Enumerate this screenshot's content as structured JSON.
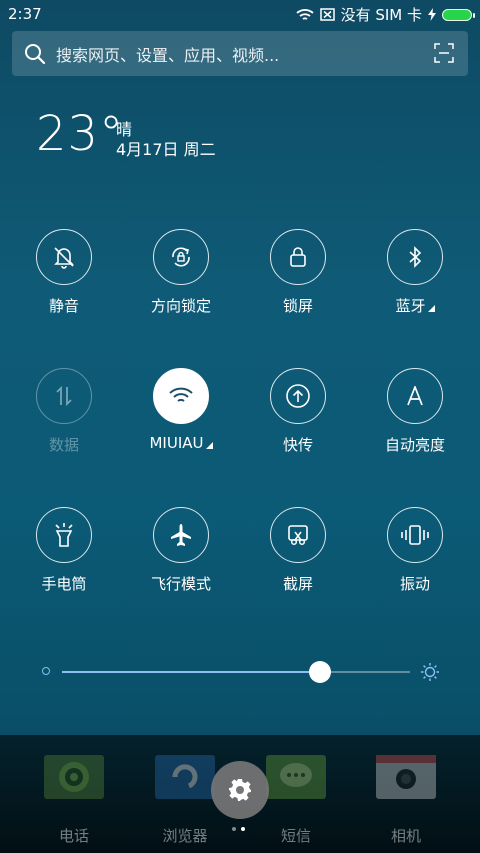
{
  "status_bar": {
    "time": "2:37",
    "carrier": "没有 SIM 卡"
  },
  "search": {
    "placeholder": "搜索网页、设置、应用、视频..."
  },
  "weather": {
    "temperature": "23°",
    "condition": "晴",
    "date": "4月17日 周二"
  },
  "toggles": [
    {
      "label": "静音",
      "icon": "bell-off-icon",
      "state": "off"
    },
    {
      "label": "方向锁定",
      "icon": "rotation-lock-icon",
      "state": "off"
    },
    {
      "label": "锁屏",
      "icon": "lock-icon",
      "state": "off"
    },
    {
      "label": "蓝牙",
      "icon": "bluetooth-icon",
      "state": "off"
    },
    {
      "label": "数据",
      "icon": "data-arrows-icon",
      "state": "disabled"
    },
    {
      "label": "MIUIAU",
      "icon": "wifi-icon",
      "state": "on"
    },
    {
      "label": "快传",
      "icon": "upload-icon",
      "state": "off"
    },
    {
      "label": "自动亮度",
      "icon": "auto-brightness-icon",
      "state": "off"
    },
    {
      "label": "手电筒",
      "icon": "flashlight-icon",
      "state": "off"
    },
    {
      "label": "飞行模式",
      "icon": "airplane-icon",
      "state": "off"
    },
    {
      "label": "截屏",
      "icon": "screenshot-icon",
      "state": "off"
    },
    {
      "label": "振动",
      "icon": "vibrate-icon",
      "state": "off"
    }
  ],
  "brightness": {
    "level": 0.74
  },
  "dock": {
    "apps": [
      {
        "label": "电话",
        "color": "#5a8a3a"
      },
      {
        "label": "浏览器",
        "color": "#2a6fb5"
      },
      {
        "label": "短信",
        "color": "#6aa63a"
      },
      {
        "label": "相机",
        "color": "#d9d9d9"
      }
    ],
    "page_count": 2,
    "active_page": 2
  },
  "colors": {
    "accent": "#96c8ff",
    "battery": "#27d44a"
  }
}
